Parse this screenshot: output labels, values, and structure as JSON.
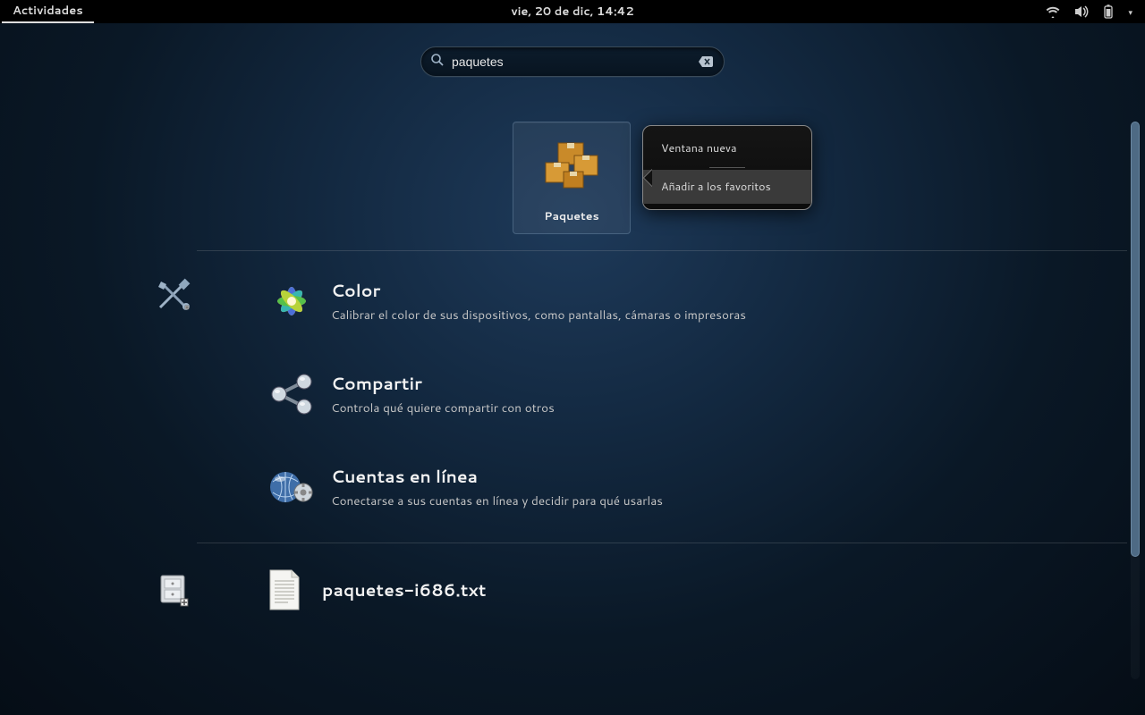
{
  "topbar": {
    "activities": "Actividades",
    "clock": "vie, 20 de dic, 14:42"
  },
  "search": {
    "value": "paquetes"
  },
  "app_result": {
    "label": "Paquetes",
    "icon": "package-boxes-icon"
  },
  "context_menu": {
    "items": [
      {
        "label": "Ventana nueva",
        "highlight": false
      },
      {
        "label": "Añadir a los favoritos",
        "highlight": true
      }
    ]
  },
  "settings_results": [
    {
      "title": "Color",
      "desc": "Calibrar el color de sus dispositivos, como pantallas, cámaras o impresoras",
      "icon": "color-flower-icon"
    },
    {
      "title": "Compartir",
      "desc": "Controla qué quiere compartir con otros",
      "icon": "share-icon"
    },
    {
      "title": "Cuentas en línea",
      "desc": "Conectarse a sus cuentas en línea y decidir para qué usarlas",
      "icon": "globe-gear-icon"
    }
  ],
  "file_result": {
    "name": "paquetes-i686.txt",
    "icon": "text-file-icon"
  }
}
